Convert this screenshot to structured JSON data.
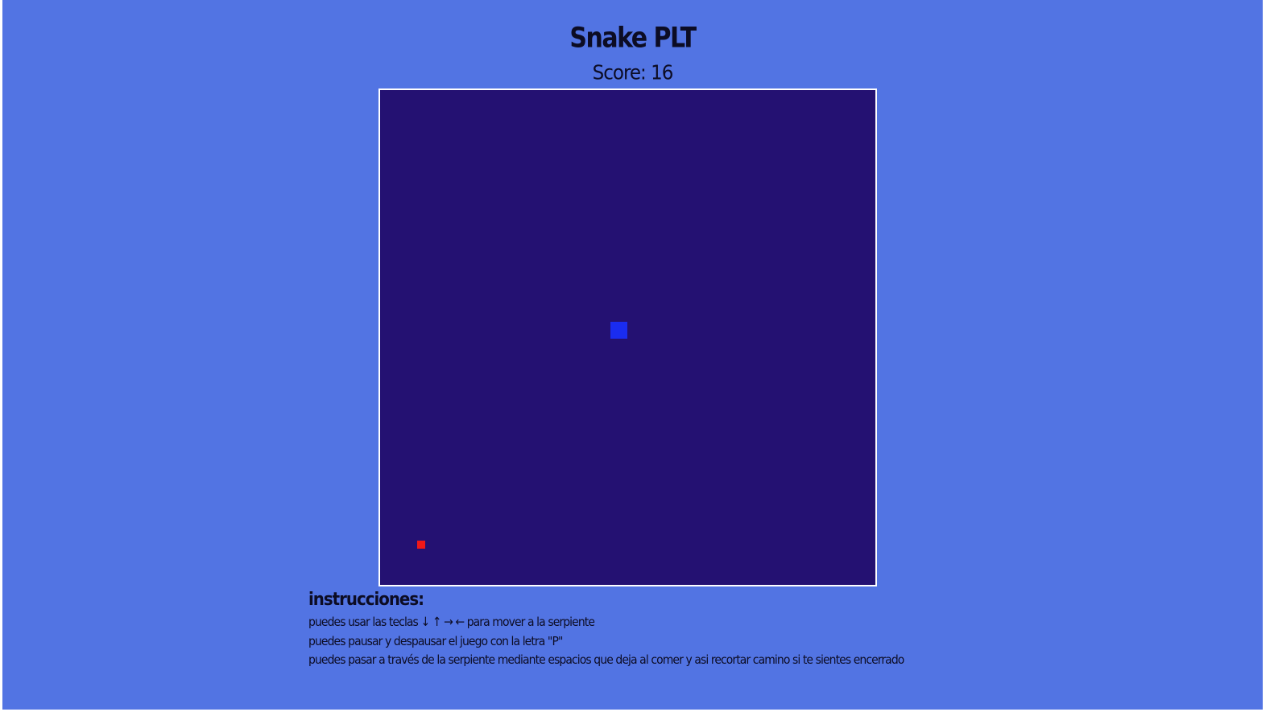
{
  "game": {
    "title": "Snake PLT",
    "score_label": "Score: 16"
  },
  "board": {
    "snake_color": "#1a2cf0",
    "food_color": "#f01818",
    "background_color": "#241172"
  },
  "instructions": {
    "heading": "instrucciones:",
    "lines": [
      "puedes usar las teclas ↓ ↑ → ← para mover a la serpiente",
      "puedes pausar y despausar el juego con la letra \"P\"",
      "puedes pasar a través de la serpiente mediante espacios que deja al comer y asi recortar camino si te sientes encerrado"
    ]
  }
}
